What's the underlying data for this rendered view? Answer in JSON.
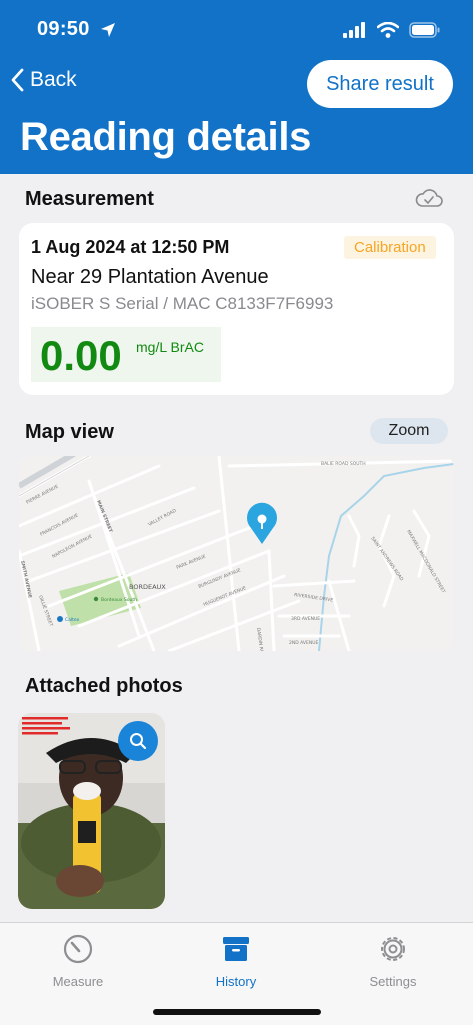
{
  "status_bar": {
    "time": "09:50"
  },
  "nav": {
    "back_label": "Back",
    "share_label": "Share result",
    "title": "Reading details"
  },
  "measurement": {
    "section_title": "Measurement",
    "date": "1 Aug 2024 at 12:50 PM",
    "badge": "Calibration",
    "location": "Near 29 Plantation Avenue",
    "device": "iSOBER S Serial / MAC C8133F7F6993",
    "value": "0.00",
    "unit": "mg/L BrAC",
    "value_color": "#128a12"
  },
  "map": {
    "section_title": "Map view",
    "zoom_label": "Zoom",
    "labels": {
      "balie_road": "BALIE ROAD SOUTH",
      "pierre": "PIERRE AVENUE",
      "francois": "FRANCOIS AVENUE",
      "napoleon": "NAPOLEON AVENUE",
      "main_street": "MAIN STREET",
      "valley_road": "VALLEY ROAD",
      "park_avenue": "PARK AVENUE",
      "bordeaux": "BORDEAUX",
      "bordeaux_south": "Bordeaux South",
      "burgundy": "BURGUNDY AVENUE",
      "huguenot": "HUGUENOT AVENUE",
      "riverside": "RIVERSIDE DRIVE",
      "third_ave": "3RD AVENUE",
      "second_ave": "2ND AVENUE",
      "dardin": "DARDIN ROAD",
      "saint_andrews": "SAINT ANDREWS ROAD",
      "maxwell": "MAXWELL MACDONALD STREET",
      "smith": "SMITH AVENUE",
      "gillie": "GILLIE STREET",
      "caltex": "Caltex"
    }
  },
  "photos": {
    "section_title": "Attached photos"
  },
  "tabs": [
    {
      "label": "Measure",
      "icon": "gauge-icon"
    },
    {
      "label": "History",
      "icon": "archive-box-icon"
    },
    {
      "label": "Settings",
      "icon": "gear-icon"
    }
  ],
  "colors": {
    "brand": "#1172c7",
    "badge_text": "#f5a623",
    "active_tab": "#1172c7"
  }
}
